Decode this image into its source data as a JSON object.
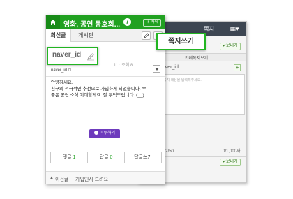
{
  "compose_screen": {
    "header_title": "쪽지",
    "grid_icon": "grid-icon",
    "send_label": "보내기",
    "tabs": [
      "",
      "카페쪽지보기"
    ],
    "recipient": "naver_id",
    "add_icon": "plus-icon",
    "placeholder": "쪽지 내용을 입력해주세요.",
    "count_left": "최 2/50",
    "count_right": "0/1,000자"
  },
  "article_screen": {
    "cafe_title": "영화, 공연 동호회...",
    "info_icon": "info-icon",
    "mycafe_label": "내 카페",
    "tabs": [
      "최신글",
      "게시판"
    ],
    "meta": "11 : 조회 8",
    "author": "naver_id",
    "body_lines": [
      "안녕하세요.",
      "친구의 적극적인 추천으로 가입하게 되었습니다. ^^",
      "좋은 공연 소식 기대할게요. 잘 부탁드립니다. (__)"
    ],
    "like_label": "이투하기",
    "comment_bar": {
      "comment_label": "댓글",
      "comment_count": "1",
      "reply_label": "답글",
      "reply_count": "0",
      "write_reply_label": "답글쓰기"
    },
    "prev": {
      "label": "이전글",
      "title": "가입인사 드려요"
    }
  },
  "callouts": {
    "user_id": "naver_id",
    "write_note": "쪽지쓰기"
  },
  "colors": {
    "header_green": "#21a121",
    "callout_border": "#22b522",
    "like_purple": "#6e3bbd",
    "back_header": "#3d4652"
  }
}
